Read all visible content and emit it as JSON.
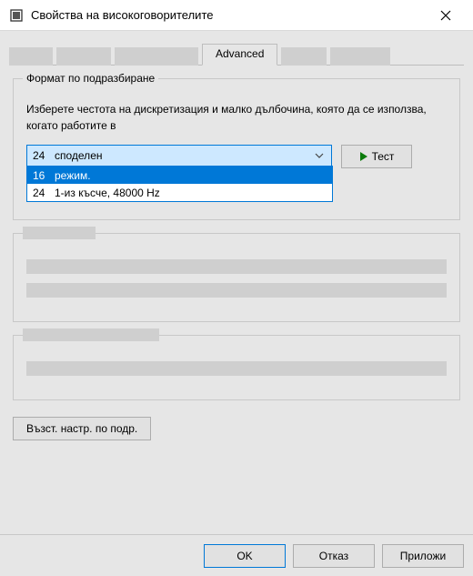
{
  "window": {
    "title": "Свойства на високоговорителите"
  },
  "tabs": {
    "active": "Advanced"
  },
  "group_format": {
    "label": "Формат по подразбиране",
    "description": "Изберете честота на дискретизация и малко дълбочина, която да се използва, когато работите в",
    "combo": {
      "selected_prefix": "24",
      "selected_rest": "споделен",
      "options": [
        {
          "prefix": "16",
          "label": "режим."
        },
        {
          "prefix": "24",
          "label": "1-из късче, 48000 Hz"
        }
      ]
    },
    "test_button": "Тест"
  },
  "restore_button": "Възст. настр. по подр.",
  "footer": {
    "ok": "OK",
    "cancel": "Отказ",
    "apply": "Приложи"
  }
}
